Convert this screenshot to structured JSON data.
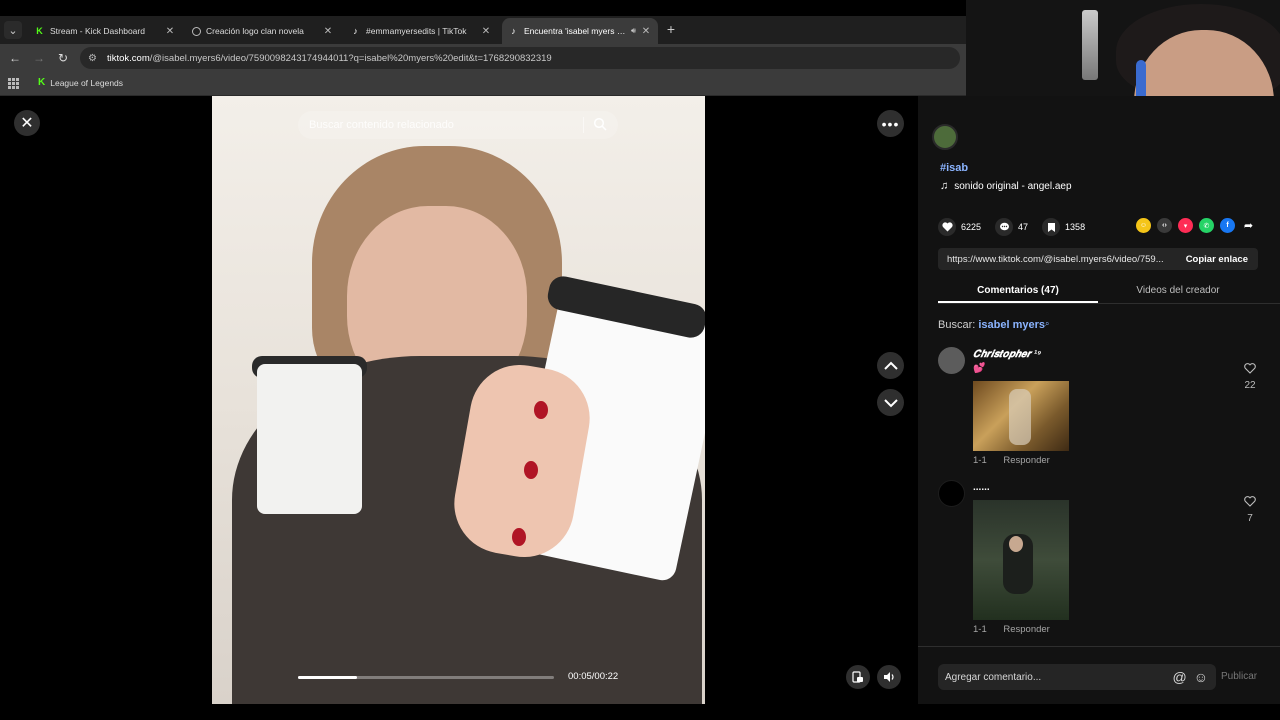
{
  "browser": {
    "tabs": [
      {
        "title": "Stream - Kick Dashboard",
        "favicon": "kick-icon",
        "active": false
      },
      {
        "title": "Creación logo clan novela",
        "favicon": "globe-icon",
        "active": false
      },
      {
        "title": "#emmamyersedits | TikTok",
        "favicon": "tiktok-icon",
        "active": false
      },
      {
        "title": "Encuentra 'isabel myers edi",
        "favicon": "tiktok-icon",
        "active": true
      }
    ],
    "url_host": "tiktok.com",
    "url_rest": "/@isabel.myers6/video/7590098243174944011?q=isabel%20myers%20edit&t=1768290832319",
    "bookmark": "League of Legends"
  },
  "video": {
    "search_placeholder": "Buscar contenido relacionado",
    "time": "00:05/00:22",
    "progress": 0.23
  },
  "panel": {
    "hashtag": "#isab",
    "sound": "sonido original - angel.aep",
    "likes": "6225",
    "comments_count": "47",
    "saves": "1358",
    "share_colors": [
      "#f5c518",
      "#3a3a3a",
      "#fe2c55",
      "#25d366",
      "#1877f2"
    ],
    "link": "https://www.tiktok.com/@isabel.myers6/video/759...",
    "copy_label": "Copiar enlace",
    "tab_comments": "Comentarios (47)",
    "tab_creator": "Videos del creador",
    "search_prefix": "Buscar:",
    "search_query": "isabel myers",
    "comments": [
      {
        "user": "𝑪𝒉𝒓𝒊𝒔𝒕𝒐𝒑𝒉𝒆𝒓 ¹⁹",
        "text": "💕",
        "reply_count": "1-1",
        "reply_label": "Responder",
        "likes": "22"
      },
      {
        "user": "......",
        "text": "",
        "reply_count": "1-1",
        "reply_label": "Responder",
        "likes": "7"
      }
    ],
    "comment_placeholder": "Agregar comentario...",
    "publish_label": "Publicar"
  }
}
